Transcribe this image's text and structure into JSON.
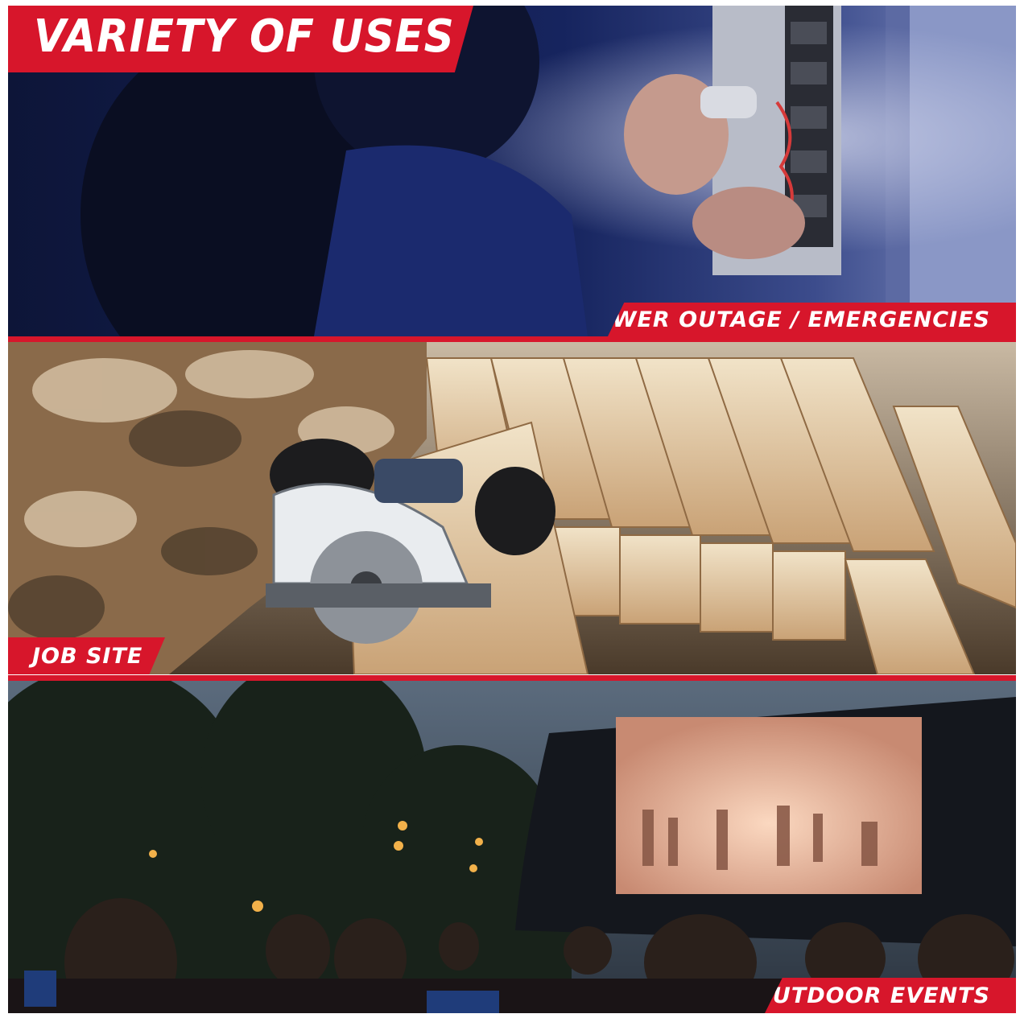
{
  "title": "VARIETY OF USES",
  "panels": [
    {
      "caption": "POWER OUTAGE / EMERGENCIES"
    },
    {
      "caption": "JOB SITE"
    },
    {
      "caption": "OUTDOOR EVENTS"
    }
  ],
  "colors": {
    "accent": "#d7162b",
    "text": "#ffffff"
  }
}
